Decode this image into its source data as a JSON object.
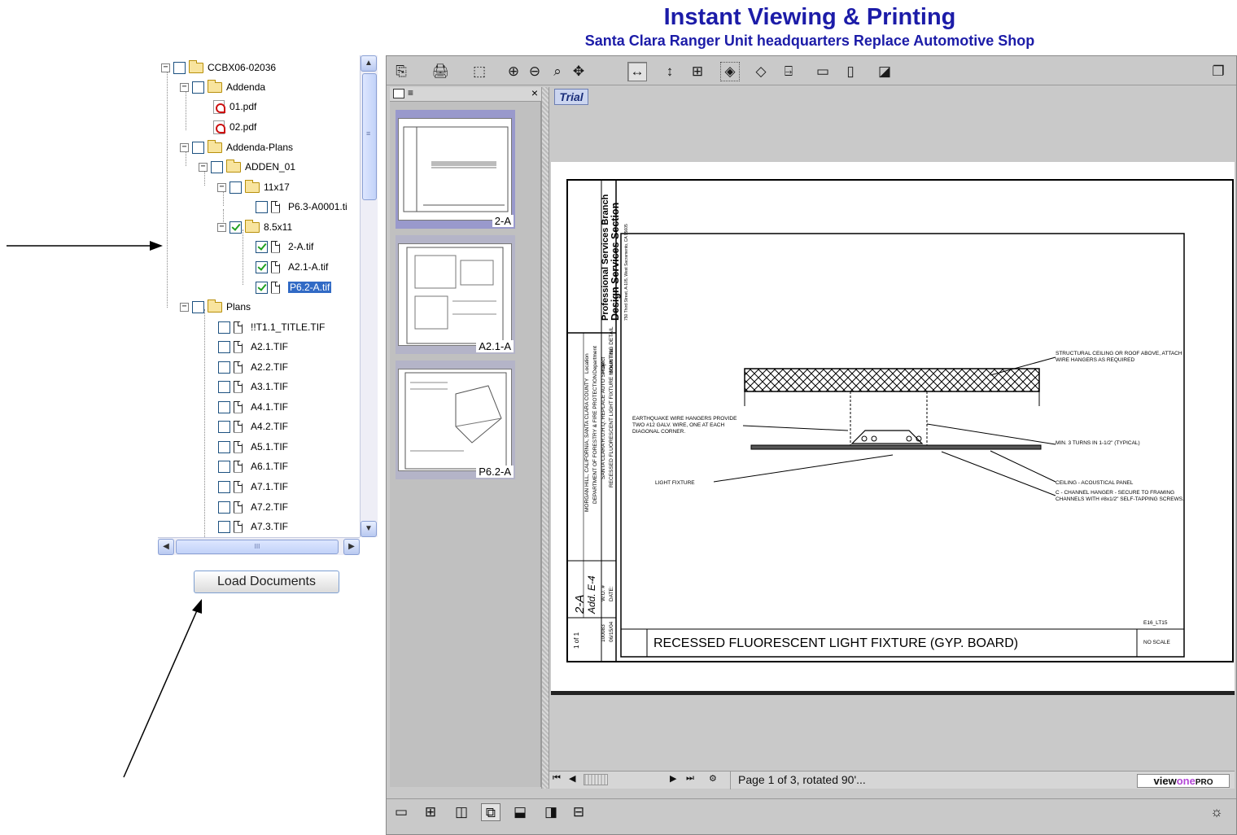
{
  "header": {
    "title": "Instant Viewing & Printing",
    "subtitle": "Santa Clara Ranger Unit headquarters Replace Automotive Shop"
  },
  "tree": {
    "items": [
      {
        "label": "CCBX06-02036",
        "type": "folder",
        "checked": false
      },
      {
        "label": "Addenda",
        "type": "folder",
        "checked": false
      },
      {
        "label": "01.pdf",
        "type": "pdf"
      },
      {
        "label": "02.pdf",
        "type": "pdf"
      },
      {
        "label": "Addenda-Plans",
        "type": "folder",
        "checked": false
      },
      {
        "label": "ADDEN_01",
        "type": "folder",
        "checked": false
      },
      {
        "label": "11x17",
        "type": "folder",
        "checked": false
      },
      {
        "label": "P6.3-A0001.ti",
        "type": "file",
        "checked": false
      },
      {
        "label": "8.5x11",
        "type": "folder",
        "checked": true
      },
      {
        "label": "2-A.tif",
        "type": "file",
        "checked": true
      },
      {
        "label": "A2.1-A.tif",
        "type": "file",
        "checked": true
      },
      {
        "label": "P6.2-A.tif",
        "type": "file",
        "checked": true,
        "selected": true
      },
      {
        "label": "Plans",
        "type": "folder",
        "checked": false
      },
      {
        "label": "!!T1.1_TITLE.TIF",
        "type": "file",
        "checked": false
      },
      {
        "label": "A2.1.TIF",
        "type": "file",
        "checked": false
      },
      {
        "label": "A2.2.TIF",
        "type": "file",
        "checked": false
      },
      {
        "label": "A3.1.TIF",
        "type": "file",
        "checked": false
      },
      {
        "label": "A4.1.TIF",
        "type": "file",
        "checked": false
      },
      {
        "label": "A4.2.TIF",
        "type": "file",
        "checked": false
      },
      {
        "label": "A5.1.TIF",
        "type": "file",
        "checked": false
      },
      {
        "label": "A6.1.TIF",
        "type": "file",
        "checked": false
      },
      {
        "label": "A7.1.TIF",
        "type": "file",
        "checked": false
      },
      {
        "label": "A7.2.TIF",
        "type": "file",
        "checked": false
      },
      {
        "label": "A7.3.TIF",
        "type": "file",
        "checked": false
      }
    ],
    "expander_symbol": "−",
    "hscroll_grip": "III",
    "vscroll_grip": "≡"
  },
  "load_button": {
    "label": "Load Documents"
  },
  "viewer": {
    "trial_badge": "Trial",
    "thumbnails": [
      {
        "label": "2-A",
        "active": true
      },
      {
        "label": "A2.1-A",
        "active": false
      },
      {
        "label": "P6.2-A",
        "active": false
      }
    ],
    "status_text": "Page 1 of 3, rotated 90'...",
    "brand": {
      "part1": "view",
      "part2": "one",
      "part3": "PRO"
    },
    "drawing": {
      "title_block_1": "Professional Services Branch",
      "title_block_2": "Design Services Section",
      "title_block_addr": "750 Third Street, A-105, West Sacramento, CA 95605",
      "sheet_title_label": "Sheet Title",
      "sheet_title": "RECESSED FLUORESCENT LIGHT FIXTURE MOUNTING DETAIL",
      "date_label": "DATE:",
      "date": "06/15/04",
      "project_label": "Project",
      "project": "SANTA CLARA R.U.H.Q. REPLACE AUTO SHOP",
      "department_label": "Department",
      "department": "DEPARTMENT OF FORESTRY & FIRE PROTECTION",
      "wo_label": "W.O. #",
      "wo": "100083",
      "location_label": "Location",
      "location": "MORGAN HILL, CALIFORNIA, SANTA CLARA COUNTY",
      "sheet_num": "2-A",
      "sheet_sub": "Add. E-4",
      "sheet_of": "1 of 1",
      "note_structural": "STRUCTURAL CEILING OR ROOF ABOVE, ATTACH WIRE HANGERS AS REQUIRED",
      "note_earthquake": "EARTHQUAKE WIRE HANGERS PROVIDE TWO #12 GALV. WIRE, ONE AT EACH DIAGONAL CORNER.",
      "note_turns": "MIN. 3 TURNS IN 1-1/2\" (TYPICAL)",
      "note_light": "LIGHT FIXTURE",
      "note_ceiling": "CEILING - ACOUSTICAL PANEL",
      "note_channel": "C - CHANNEL HANGER - SECURE TO FRAMING CHANNELS WITH #8x1/2\" SELF-TAPPING SCREWS.",
      "detail_id": "E16_LT15",
      "caption": "RECESSED FLUORESCENT LIGHT FIXTURE (GYP. BOARD)",
      "scale": "NO SCALE"
    }
  }
}
